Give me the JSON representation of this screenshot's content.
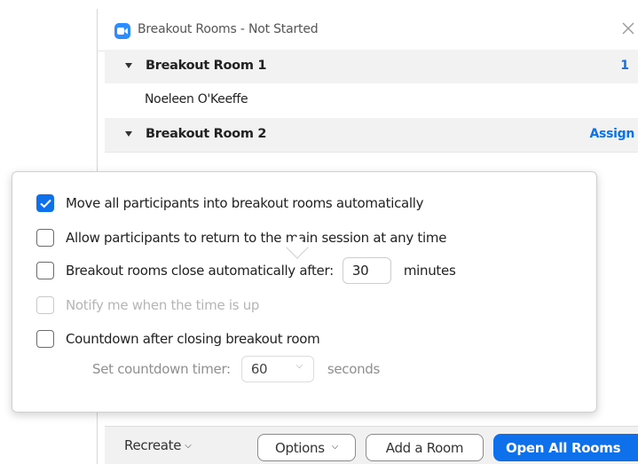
{
  "window": {
    "title": "Breakout Rooms - Not Started",
    "close_glyph": "✕"
  },
  "rooms": [
    {
      "name": "Breakout Room 1",
      "count": "1",
      "participants": [
        "Noeleen O'Keeffe"
      ]
    },
    {
      "name": "Breakout Room 2",
      "action": "Assign"
    }
  ],
  "options": {
    "move_auto": {
      "label": "Move all participants into breakout rooms automatically",
      "checked": true
    },
    "allow_return": {
      "label": "Allow participants to return to the main session at any time",
      "checked": false
    },
    "close_auto": {
      "label": "Breakout rooms close automatically after:",
      "value": "30",
      "unit": "minutes",
      "checked": false
    },
    "notify": {
      "label": "Notify me when the time is up",
      "checked": false,
      "disabled": true
    },
    "countdown": {
      "label": "Countdown after closing breakout room",
      "checked": false
    },
    "countdown_timer": {
      "label": "Set countdown timer:",
      "value": "60",
      "unit": "seconds"
    }
  },
  "bottom_bar": {
    "recreate": "Recreate",
    "options": "Options",
    "add_room": "Add a Room",
    "open_all": "Open All Rooms"
  },
  "colors": {
    "accent": "#0e71eb",
    "zoom_icon": "#2d8cff"
  }
}
